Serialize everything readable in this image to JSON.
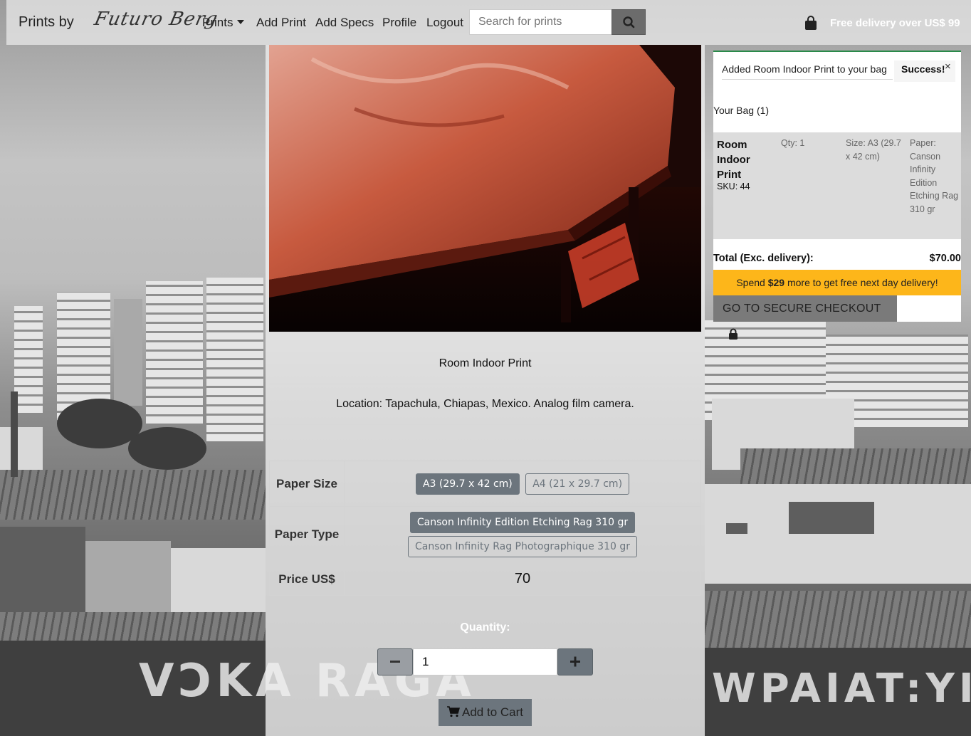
{
  "header": {
    "brand": "Prints by",
    "logo_text": "Futuro Berg",
    "nav": [
      {
        "label": "Prints",
        "dropdown": true
      },
      {
        "label": "Add Print"
      },
      {
        "label": "Add Specs"
      },
      {
        "label": "Profile"
      },
      {
        "label": "Logout"
      }
    ],
    "search_placeholder": "Search for prints",
    "free_delivery": "Free delivery over US$ 99"
  },
  "product": {
    "title": "Room Indoor Print",
    "description": "Location: Tapachula, Chiapas, Mexico. Analog film camera.",
    "paper_size_label": "Paper Size",
    "paper_sizes": [
      {
        "label": "A3 (29.7 x 42 cm)",
        "selected": true
      },
      {
        "label": "A4 (21 x 29.7 cm)",
        "selected": false
      }
    ],
    "paper_type_label": "Paper Type",
    "paper_types": [
      {
        "label": "Canson Infinity Edition Etching Rag 310 gr",
        "selected": true
      },
      {
        "label": "Canson Infinity Rag Photographique 310 gr",
        "selected": false
      }
    ],
    "price_label": "Price US$",
    "price": "70",
    "quantity_label": "Quantity:",
    "quantity": "1",
    "add_to_cart": "Add to Cart"
  },
  "bag": {
    "toast_message": "Added Room Indoor Print to your bag",
    "toast_status": "Success!",
    "close": "×",
    "title": "Your Bag (1)",
    "item": {
      "name": "Room Indoor Print",
      "sku": "SKU: 44",
      "qty": "Qty: 1",
      "size": "Size: A3 (29.7 x 42 cm)",
      "paper": "Paper: Canson Infinity Edition Etching Rag 310 gr"
    },
    "total_label": "Total (Exc. delivery):",
    "total_value": "$70.00",
    "spend_pre": "Spend ",
    "spend_amount": "$29",
    "spend_post": " more to get free next day delivery!",
    "checkout": "GO TO SECURE CHECKOUT"
  },
  "graffiti": {
    "left": "VƆKA  RAGA",
    "right": "WPAIAT:YIKO"
  },
  "icons": {
    "search": "search-icon",
    "bag": "shopping-bag-icon",
    "lock": "lock-icon",
    "cart": "cart-icon",
    "minus": "minus-icon",
    "plus": "plus-icon",
    "close": "close-icon"
  },
  "colors": {
    "secondary": "#6c757d",
    "warning": "#fdb61a",
    "success_border": "#2a8a4a"
  }
}
